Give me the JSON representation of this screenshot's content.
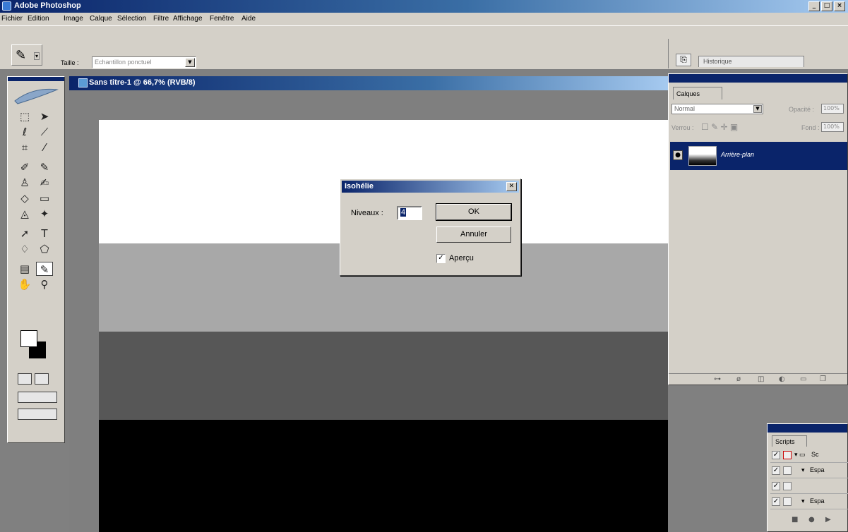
{
  "app": {
    "title": "Adobe Photoshop",
    "window_buttons": [
      "_",
      "□",
      "×"
    ]
  },
  "menu": [
    "Fichier",
    "Edition",
    "Image",
    "Calque",
    "Sélection",
    "Filtre",
    "Affichage",
    "Fenêtre",
    "Aide"
  ],
  "options_bar": {
    "sample_size_label": "Taille :",
    "sample_size_value": "Echantillon ponctuel",
    "history_tab_label": "Historique"
  },
  "document": {
    "title": "Sans titre-1 @ 66,7% (RVB/8)",
    "bands": [
      "#ffffff",
      "#a8a8a8",
      "#575757",
      "#000000"
    ]
  },
  "dialog": {
    "title": "Isohélie",
    "levels_label": "Niveaux :",
    "levels_value": "4",
    "ok_label": "OK",
    "cancel_label": "Annuler",
    "preview_label": "Aperçu",
    "preview_checked": true
  },
  "layers_panel": {
    "tab_label": "Calques",
    "blend_mode": "Normal",
    "opacity_label": "Opacité :",
    "opacity_value": "100%",
    "lock_label": "Verrou :",
    "fill_label": "Fond :",
    "fill_value": "100%",
    "layer_name": "Arrière-plan"
  },
  "scripts_panel": {
    "tab_label": "Scripts",
    "rows": [
      {
        "label": "Sc",
        "checked": true
      },
      {
        "label": "Espa",
        "checked": true
      },
      {
        "label": "",
        "checked": true
      },
      {
        "label": "Espa",
        "checked": true
      }
    ]
  },
  "colors": {
    "title_gradient_start": "#0a246a",
    "title_gradient_end": "#a6caf0",
    "chrome": "#d4d0c8",
    "workspace": "#808080"
  }
}
